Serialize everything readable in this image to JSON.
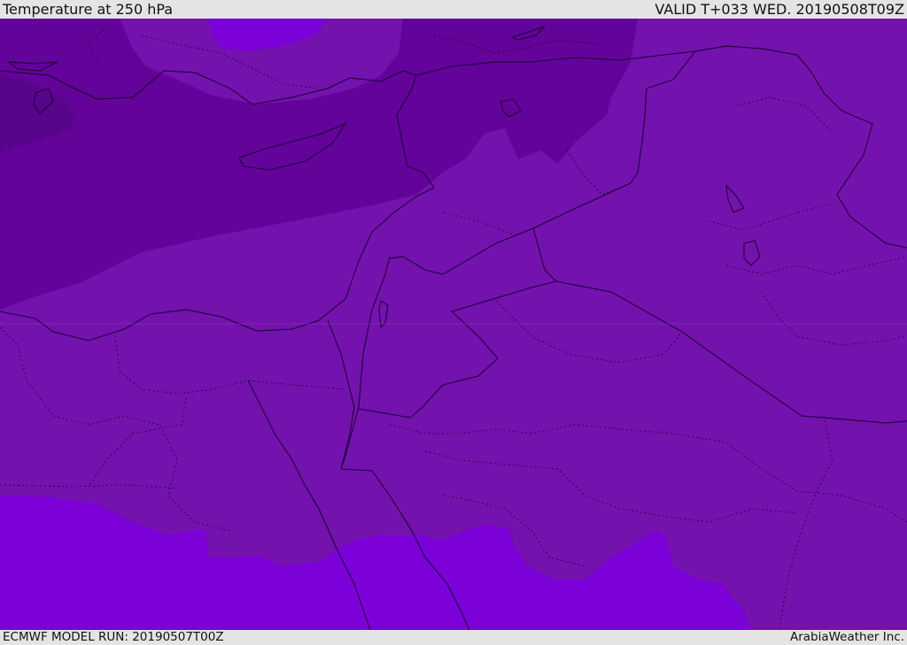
{
  "header": {
    "title": "Temperature at 250 hPa",
    "valid_time": "VALID T+033 WED. 20190508T09Z"
  },
  "footer": {
    "model_run": "ECMWF MODEL RUN: 20190507T00Z",
    "credit": "ArabiaWeather Inc."
  },
  "colors": {
    "darkest_band": "#57058a",
    "dark_band": "#63039a",
    "mid_band": "#7412ae",
    "light_band": "#7c00d8",
    "border_line": "#1a0030"
  },
  "map": {
    "variable": "Temperature",
    "level": "250 hPa"
  }
}
